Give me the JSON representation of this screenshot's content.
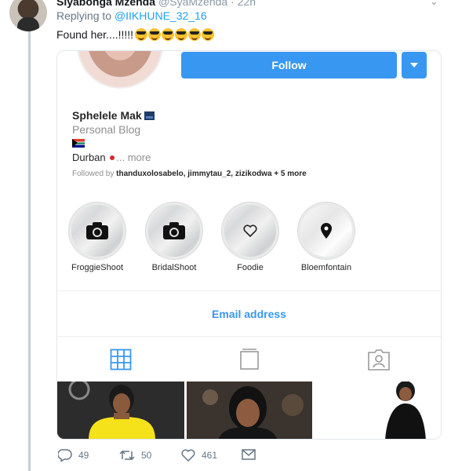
{
  "tweet": {
    "author_name": "Siyabonga Mzehda",
    "author_handle": "@SyaMzehda · 22h",
    "replying_prefix": "Replying to",
    "replying_handle": "@IIKHUNE_32_16",
    "text": "Found her....!!!!!"
  },
  "profile": {
    "follow_label": "Follow",
    "name": "Sphelele Mak",
    "category": "Personal Blog",
    "location": "Durban",
    "more_label": "... more",
    "followed_prefix": "Followed by",
    "followed_users": "thanduxolosabelo, jimmytau_2, zizikodwa",
    "followed_more": "+ 5 more",
    "email_label": "Email address"
  },
  "highlights": [
    {
      "label": "FroggieShoot",
      "icon": "camera-icon"
    },
    {
      "label": "BridalShoot",
      "icon": "camera-icon"
    },
    {
      "label": "Foodie",
      "icon": "heart-icon"
    },
    {
      "label": "Bloemfontain",
      "icon": "location-pin-icon"
    }
  ],
  "tabs": [
    {
      "name": "grid",
      "icon": "grid-icon",
      "active": true
    },
    {
      "name": "igtv",
      "icon": "tv-icon",
      "active": false
    },
    {
      "name": "tagged",
      "icon": "tagged-user-icon",
      "active": false
    }
  ],
  "actions": {
    "replies": "49",
    "retweets": "50",
    "likes": "461"
  },
  "colors": {
    "instagram_blue": "#3897f0",
    "twitter_blue": "#1da1f2",
    "thread_line": "#c4cfd6"
  }
}
